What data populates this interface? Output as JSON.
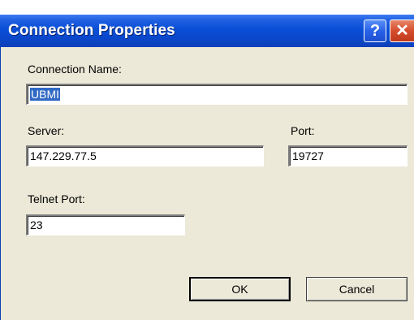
{
  "window": {
    "title": "Connection Properties",
    "help_glyph": "?",
    "close_glyph": "✕"
  },
  "form": {
    "connection_name_label": "Connection Name:",
    "connection_name_value": "UBMI",
    "server_label": "Server:",
    "server_value": "147.229.77.5",
    "port_label": "Port:",
    "port_value": "19727",
    "telnet_port_label": "Telnet Port:",
    "telnet_port_value": "23"
  },
  "buttons": {
    "ok_label": "OK",
    "cancel_label": "Cancel"
  },
  "colors": {
    "titlebar": "#0a4fd8",
    "dialog_face": "#ece9d8",
    "selection": "#316ac5",
    "close_button": "#d44d2c"
  }
}
